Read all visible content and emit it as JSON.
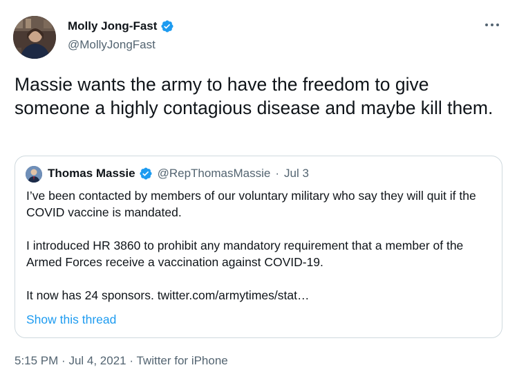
{
  "tweet": {
    "author": {
      "name": "Molly Jong-Fast",
      "handle": "@MollyJongFast",
      "verified": true
    },
    "more_icon": "more-dots-icon",
    "text": "Massie wants the army to have the freedom to give someone a highly contagious disease and maybe kill them.",
    "quoted": {
      "author_name": "Thomas Massie",
      "handle": "@RepThomasMassie",
      "separator": "·",
      "date": "Jul 3",
      "verified": true,
      "paragraphs": [
        "I’ve been contacted by members of our voluntary military who say they will quit if the COVID vaccine is mandated.",
        "I introduced HR 3860 to prohibit any mandatory requirement that a member of the Armed Forces receive a vaccination against COVID-19.",
        "It now has 24 sponsors. twitter.com/armytimes/stat…"
      ],
      "show_thread": "Show this thread"
    },
    "footer": {
      "time": "5:15 PM",
      "sep1": "·",
      "date": "Jul 4, 2021",
      "sep2": "·",
      "source": "Twitter for iPhone"
    }
  },
  "colors": {
    "accent": "#1d9bf0",
    "secondary_text": "#536471",
    "border": "#cfd9de"
  }
}
